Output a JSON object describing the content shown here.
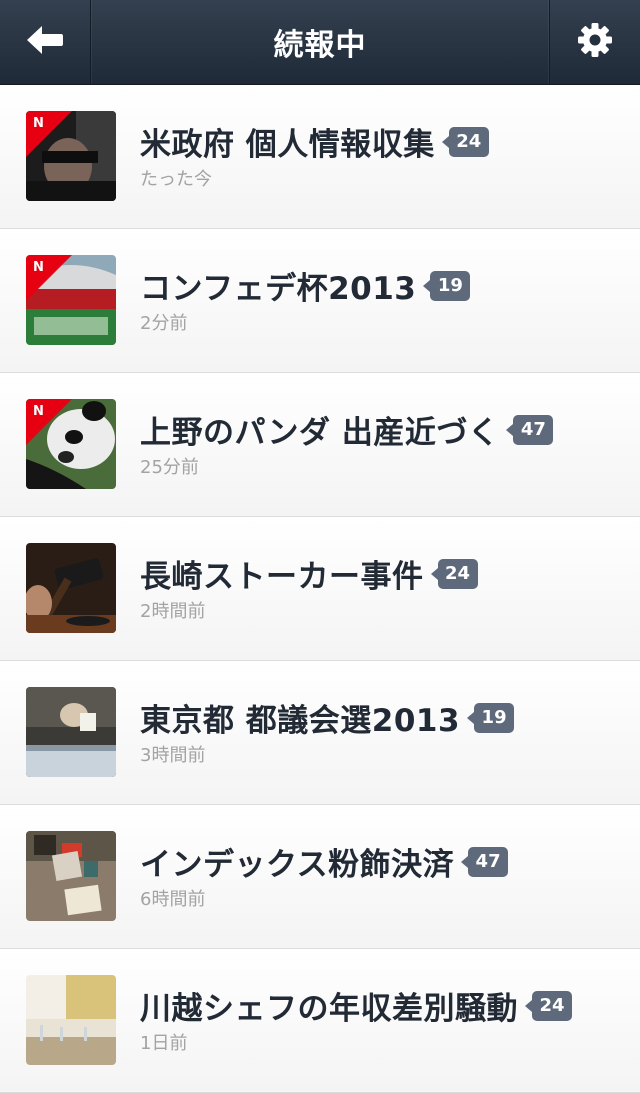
{
  "header": {
    "title": "続報中",
    "back_icon": "back-arrow-icon",
    "settings_icon": "gear-icon"
  },
  "colors": {
    "navbar": "#26313f",
    "badge": "#5e6a7b",
    "new_marker": "#e60012"
  },
  "items": [
    {
      "title": "米政府 個人情報収集",
      "count": "24",
      "time": "たった今",
      "new_label": "N"
    },
    {
      "title": "コンフェデ杯2013",
      "count": "19",
      "time": "2分前",
      "new_label": "N"
    },
    {
      "title": "上野のパンダ 出産近づく",
      "count": "47",
      "time": "25分前",
      "new_label": "N"
    },
    {
      "title": "長崎ストーカー事件",
      "count": "24",
      "time": "2時間前"
    },
    {
      "title": "東京都 都議会選2013",
      "count": "19",
      "time": "3時間前"
    },
    {
      "title": "インデックス粉飾決済",
      "count": "47",
      "time": "6時間前"
    },
    {
      "title": "川越シェフの年収差別騒動",
      "count": "24",
      "time": "1日前"
    }
  ]
}
